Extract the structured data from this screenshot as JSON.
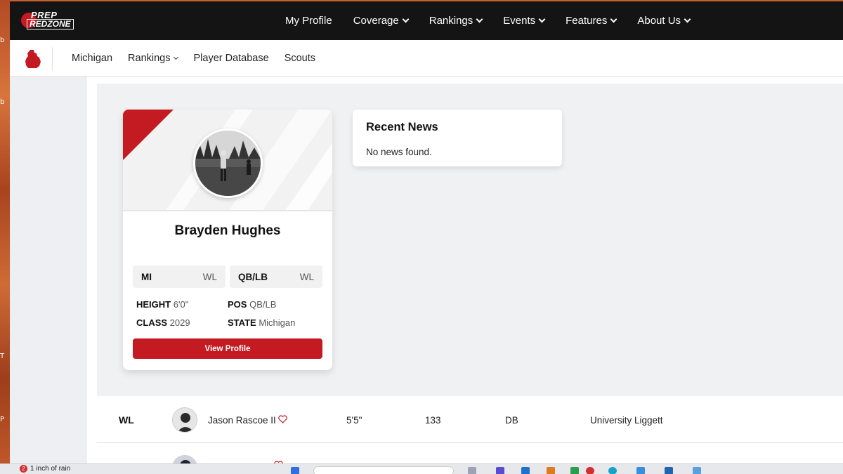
{
  "top_nav": {
    "logo_line1": "PREP",
    "logo_line2": "REDZONE",
    "items": [
      {
        "label": "My Profile",
        "has_dropdown": false
      },
      {
        "label": "Coverage",
        "has_dropdown": true
      },
      {
        "label": "Rankings",
        "has_dropdown": true
      },
      {
        "label": "Events",
        "has_dropdown": true
      },
      {
        "label": "Features",
        "has_dropdown": true
      },
      {
        "label": "About Us",
        "has_dropdown": true
      }
    ]
  },
  "sub_nav": {
    "state_icon": "michigan-state-icon",
    "items": [
      {
        "label": "Michigan"
      },
      {
        "label": "Rankings",
        "has_dropdown": true
      },
      {
        "label": "Player Database"
      },
      {
        "label": "Scouts"
      }
    ]
  },
  "profile_card": {
    "name": "Brayden Hughes",
    "state_pill": {
      "key": "MI",
      "value": "WL"
    },
    "position_pill": {
      "key": "QB/LB",
      "value": "WL"
    },
    "stats": {
      "height_label": "HEIGHT",
      "height_value": "6'0\"",
      "class_label": "CLASS",
      "class_value": "2029",
      "pos_label": "POS",
      "pos_value": "QB/LB",
      "state_label": "STATE",
      "state_value": "Michigan"
    },
    "button_label": "View Profile"
  },
  "recent_news": {
    "title": "Recent News",
    "empty_text": "No news found."
  },
  "table": {
    "rows": [
      {
        "rank": "WL",
        "name": "Jason Rascoe II",
        "height": "5'5\"",
        "weight": "133",
        "position": "DB",
        "school": "University Liggett"
      }
    ]
  },
  "taskbar": {
    "weather_badge": "2",
    "weather_text": "1 inch of rain"
  },
  "desktop_edge_text": [
    "b",
    "b",
    "T",
    "P"
  ],
  "colors": {
    "brand_red": "#c41a22",
    "topbar_bg": "#141414"
  }
}
